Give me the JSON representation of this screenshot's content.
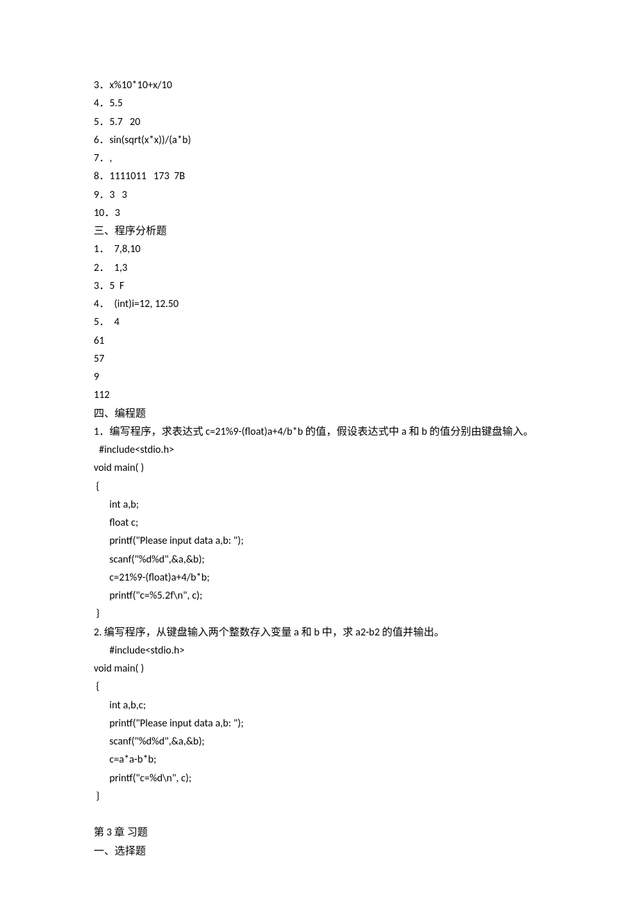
{
  "lines": [
    {
      "text": "3．x%10*10+x/10",
      "class": ""
    },
    {
      "text": "4．5.5",
      "class": ""
    },
    {
      "text": "5．5.7   20",
      "class": ""
    },
    {
      "text": "6．sin(sqrt(x*x))/(a*b)",
      "class": ""
    },
    {
      "text": "7．,",
      "class": ""
    },
    {
      "text": "8．1111011   173  7B",
      "class": ""
    },
    {
      "text": "9．3   3",
      "class": ""
    },
    {
      "text": "10．3",
      "class": ""
    },
    {
      "text": "三、程序分析题",
      "class": ""
    },
    {
      "text": "1．  7,8,10",
      "class": ""
    },
    {
      "text": "2．  1,3",
      "class": ""
    },
    {
      "text": "3．5  F",
      "class": ""
    },
    {
      "text": "4．  (int)i=12, 12.50",
      "class": ""
    },
    {
      "text": "5．  4",
      "class": ""
    },
    {
      "text": "61",
      "class": ""
    },
    {
      "text": "57",
      "class": ""
    },
    {
      "text": "9",
      "class": ""
    },
    {
      "text": "112",
      "class": ""
    },
    {
      "text": "四、编程题",
      "class": ""
    },
    {
      "text": "1．编写程序，求表达式 c=21%9-(float)a+4/b*b 的值，假设表达式中 a 和 b 的值分别由键盘输入。",
      "class": ""
    },
    {
      "text": "#include<stdio.h>",
      "class": "indent1"
    },
    {
      "text": "void main( )",
      "class": ""
    },
    {
      "text": " {",
      "class": ""
    },
    {
      "text": "int a,b;",
      "class": "indent2"
    },
    {
      "text": "float c;",
      "class": "indent2"
    },
    {
      "text": "printf(\"Please input data a,b: \");",
      "class": "indent2"
    },
    {
      "text": "scanf(\"%d%d\",&a,&b);",
      "class": "indent2"
    },
    {
      "text": "c=21%9-(float)a+4/b*b;",
      "class": "indent2"
    },
    {
      "text": "printf(\"c=%5.2f\\n\", c);",
      "class": "indent2"
    },
    {
      "text": " }",
      "class": ""
    },
    {
      "text": "2. 编写程序，从键盘输入两个整数存入变量 a 和 b 中，求 a2-b2 的值并输出。",
      "class": ""
    },
    {
      "text": "#include<stdio.h>",
      "class": "indent2"
    },
    {
      "text": "void main( )",
      "class": ""
    },
    {
      "text": " {",
      "class": ""
    },
    {
      "text": "int a,b,c;",
      "class": "indent2"
    },
    {
      "text": "printf(\"Please input data a,b: \");",
      "class": "indent2"
    },
    {
      "text": "scanf(\"%d%d\",&a,&b);",
      "class": "indent2"
    },
    {
      "text": "c=a*a-b*b;",
      "class": "indent2"
    },
    {
      "text": "printf(\"c=%d\\n\", c);",
      "class": "indent2"
    },
    {
      "text": " }",
      "class": ""
    },
    {
      "text": " ",
      "class": ""
    },
    {
      "text": "第 3 章 习题",
      "class": ""
    },
    {
      "text": "一、选择题",
      "class": ""
    }
  ]
}
